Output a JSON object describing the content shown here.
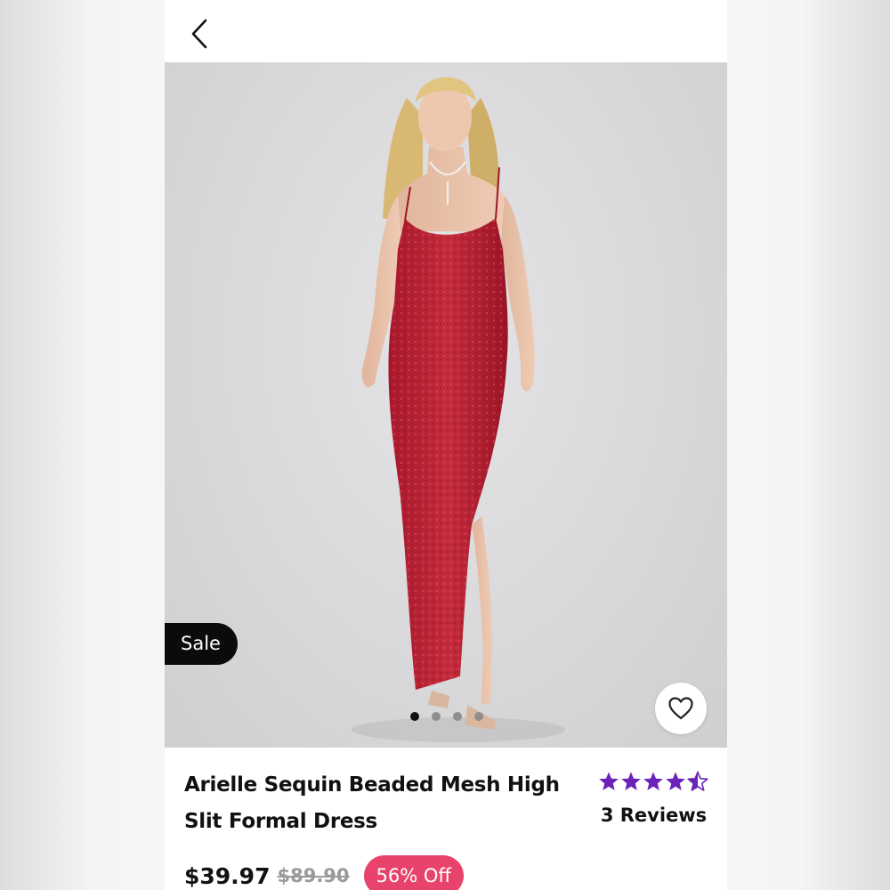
{
  "header": {
    "back_icon": "chevron-left-icon"
  },
  "gallery": {
    "badge": "Sale",
    "dot_count": 4,
    "active_dot": 0,
    "favorite_icon": "heart-outline-icon"
  },
  "product": {
    "title_line1": "Arielle Sequin Beaded Mesh High",
    "title_line2": "Slit Formal Dress",
    "rating_value": 4.5,
    "star_color": "#6a22b8",
    "reviews_label": "3 Reviews",
    "price": "$39.97",
    "original_price": "$89.90",
    "discount_label": "56% Off",
    "discount_color": "#e8446b"
  }
}
